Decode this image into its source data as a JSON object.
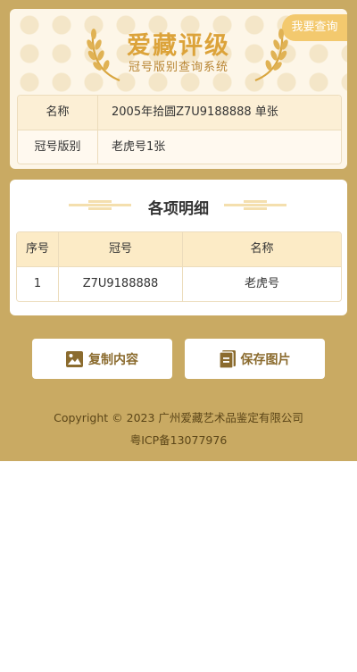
{
  "header": {
    "query_button": "我要查询",
    "logo_title": "爱藏评级",
    "logo_subtitle": "冠号版别查询系统"
  },
  "info": {
    "rows": [
      {
        "label": "名称",
        "value": "2005年拾圆Z7U9188888 单张"
      },
      {
        "label": "冠号版别",
        "value": "老虎号1张"
      }
    ]
  },
  "details": {
    "title": "各项明细",
    "columns": [
      "序号",
      "冠号",
      "名称"
    ],
    "rows": [
      {
        "index": "1",
        "serial": "Z7U9188888",
        "name": "老虎号"
      }
    ]
  },
  "actions": {
    "copy_label": "复制内容",
    "save_label": "保存图片"
  },
  "footer": {
    "copyright": "Copyright © 2023 广州爱藏艺术品鉴定有限公司",
    "icp": "粤ICP备13077976"
  },
  "colors": {
    "background_gold": "#c9aa63",
    "accent": "#f3c96e",
    "button_text": "#8b6b2e"
  }
}
